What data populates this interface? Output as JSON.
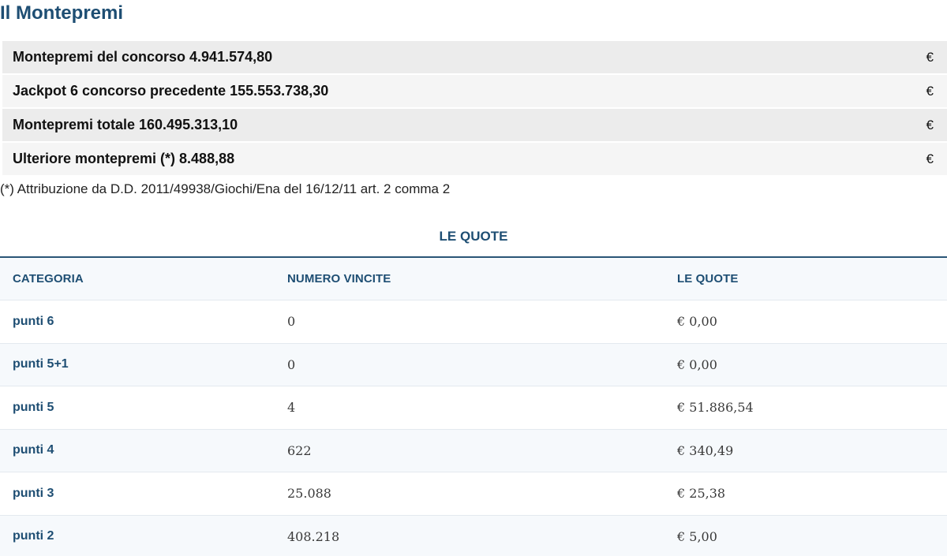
{
  "title": "Il Montepremi",
  "summary": {
    "rows": [
      {
        "label": "Montepremi del concorso 4.941.574,80",
        "currency": "€"
      },
      {
        "label": "Jackpot 6 concorso precedente 155.553.738,30",
        "currency": "€"
      },
      {
        "label": "Montepremi totale 160.495.313,10",
        "currency": "€"
      },
      {
        "label": "Ulteriore montepremi (*) 8.488,88",
        "currency": "€"
      }
    ],
    "footnote": "(*) Attribuzione da D.D. 2011/49938/Giochi/Ena del 16/12/11 art. 2 comma 2"
  },
  "quote": {
    "heading": "LE QUOTE",
    "columns": [
      "CATEGORIA",
      "NUMERO VINCITE",
      "LE QUOTE"
    ],
    "rows": [
      {
        "categoria": "punti 6",
        "vincite": "0",
        "quota": "€ 0,00"
      },
      {
        "categoria": "punti 5+1",
        "vincite": "0",
        "quota": "€ 0,00"
      },
      {
        "categoria": "punti 5",
        "vincite": "4",
        "quota": "€ 51.886,54"
      },
      {
        "categoria": "punti 4",
        "vincite": "622",
        "quota": "€ 340,49"
      },
      {
        "categoria": "punti 3",
        "vincite": "25.088",
        "quota": "€ 25,38"
      },
      {
        "categoria": "punti 2",
        "vincite": "408.218",
        "quota": "€ 5,00"
      }
    ]
  },
  "colors": {
    "accent": "#1e4e73",
    "row_alt": "#f6f9fc",
    "summary_odd": "#ececec",
    "summary_even": "#f5f5f5"
  }
}
